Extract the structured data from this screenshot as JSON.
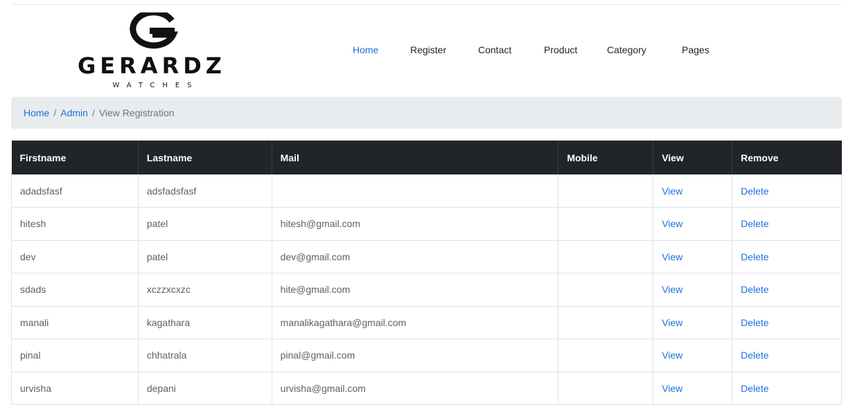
{
  "brand": {
    "name": "GERARDZ",
    "tagline": "WATCHES",
    "icon": "gerardz-g-logo-icon"
  },
  "nav": {
    "items": [
      {
        "label": "Home",
        "active": true
      },
      {
        "label": "Register",
        "active": false
      },
      {
        "label": "Contact",
        "active": false
      },
      {
        "label": "Product",
        "active": false
      },
      {
        "label": "Category",
        "active": false
      },
      {
        "label": "Pages",
        "active": false
      }
    ]
  },
  "breadcrumb": {
    "home": "Home",
    "separator": "/",
    "admin": "Admin",
    "current": "View Registration"
  },
  "table": {
    "headers": [
      "Firstname",
      "Lastname",
      "Mail",
      "Mobile",
      "View",
      "Remove"
    ],
    "rows": [
      {
        "firstname": "adadsfasf",
        "lastname": "adsfadsfasf",
        "mail": "",
        "mobile": "",
        "view": "View",
        "remove": "Delete"
      },
      {
        "firstname": "hitesh",
        "lastname": "patel",
        "mail": "hitesh@gmail.com",
        "mobile": "",
        "view": "View",
        "remove": "Delete"
      },
      {
        "firstname": "dev",
        "lastname": "patel",
        "mail": "dev@gmail.com",
        "mobile": "",
        "view": "View",
        "remove": "Delete"
      },
      {
        "firstname": "sdads",
        "lastname": "xczzxcxzc",
        "mail": "hite@gmail.com",
        "mobile": "",
        "view": "View",
        "remove": "Delete"
      },
      {
        "firstname": "manali",
        "lastname": "kagathara",
        "mail": "manalikagathara@gmail.com",
        "mobile": "",
        "view": "View",
        "remove": "Delete"
      },
      {
        "firstname": "pinal",
        "lastname": "chhatrala",
        "mail": "pinal@gmail.com",
        "mobile": "",
        "view": "View",
        "remove": "Delete"
      },
      {
        "firstname": "urvisha",
        "lastname": "depani",
        "mail": "urvisha@gmail.com",
        "mobile": "",
        "view": "View",
        "remove": "Delete"
      }
    ]
  },
  "colors": {
    "link": "#1e6fdc",
    "table_header_bg": "#212529",
    "breadcrumb_bg": "#e9ecef"
  }
}
